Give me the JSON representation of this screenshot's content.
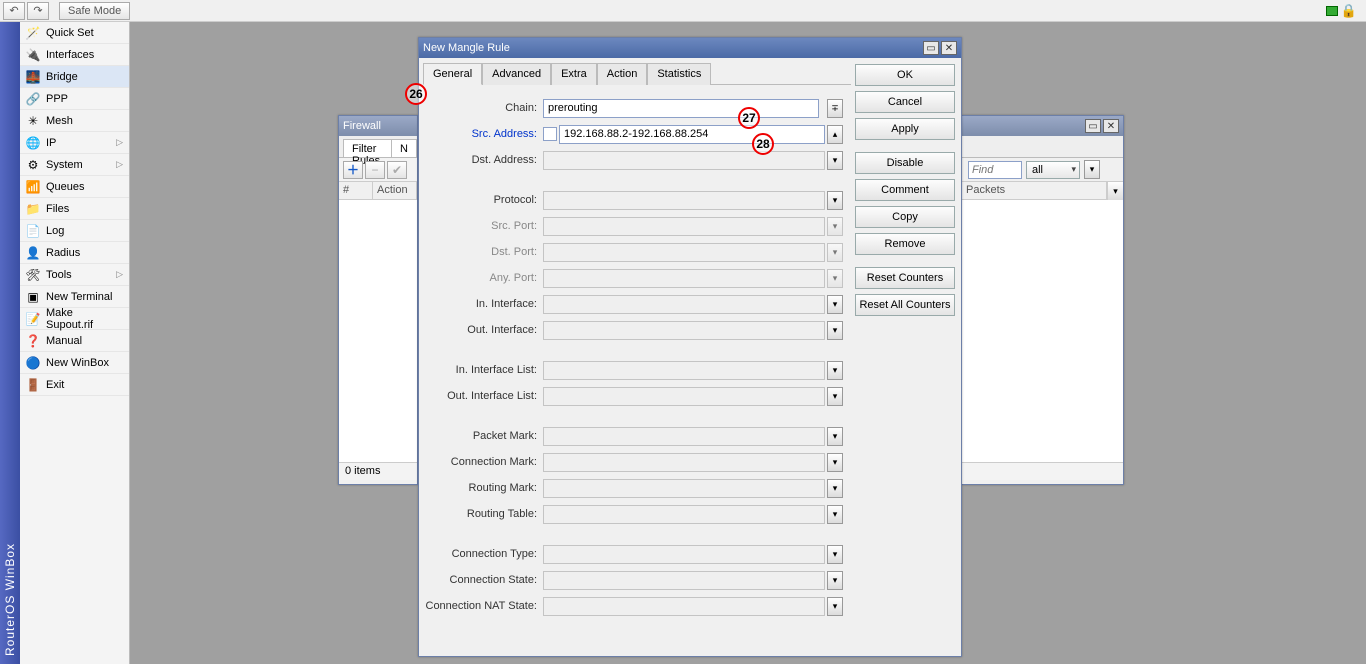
{
  "topbar": {
    "safe_mode": "Safe Mode"
  },
  "branding": "RouterOS WinBox",
  "sidebar": {
    "items": [
      {
        "label": "Quick Set",
        "icon": "🪄"
      },
      {
        "label": "Interfaces",
        "icon": "🔌"
      },
      {
        "label": "Bridge",
        "icon": "🌉",
        "active": true
      },
      {
        "label": "PPP",
        "icon": "🔗"
      },
      {
        "label": "Mesh",
        "icon": "✳"
      },
      {
        "label": "IP",
        "icon": "🌐",
        "expand": true
      },
      {
        "label": "System",
        "icon": "⚙",
        "expand": true
      },
      {
        "label": "Queues",
        "icon": "📶"
      },
      {
        "label": "Files",
        "icon": "📁"
      },
      {
        "label": "Log",
        "icon": "📄"
      },
      {
        "label": "Radius",
        "icon": "👤"
      },
      {
        "label": "Tools",
        "icon": "🛠",
        "expand": true
      },
      {
        "label": "New Terminal",
        "icon": "▣"
      },
      {
        "label": "Make Supout.rif",
        "icon": "📝"
      },
      {
        "label": "Manual",
        "icon": "❓"
      },
      {
        "label": "New WinBox",
        "icon": "🔵"
      },
      {
        "label": "Exit",
        "icon": "🚪"
      }
    ]
  },
  "firewall": {
    "title": "Firewall",
    "tabs": [
      "Filter Rules",
      "N"
    ],
    "cols": {
      "c1": "#",
      "c2": "Action"
    },
    "status": "0 items",
    "find_placeholder": "Find",
    "all": "all",
    "right_col": "Packets"
  },
  "dialog": {
    "title": "New Mangle Rule",
    "tabs": [
      "General",
      "Advanced",
      "Extra",
      "Action",
      "Statistics"
    ],
    "active_tab": 0,
    "labels": {
      "chain": "Chain:",
      "src": "Src. Address:",
      "dst": "Dst. Address:",
      "proto": "Protocol:",
      "srcport": "Src. Port:",
      "dstport": "Dst. Port:",
      "anyport": "Any. Port:",
      "inif": "In. Interface:",
      "outif": "Out. Interface:",
      "inifl": "In. Interface List:",
      "outifl": "Out. Interface List:",
      "pmark": "Packet Mark:",
      "cmark": "Connection Mark:",
      "rmark": "Routing Mark:",
      "rtable": "Routing Table:",
      "ctype": "Connection Type:",
      "cstate": "Connection State:",
      "cnat": "Connection NAT State:"
    },
    "values": {
      "chain": "prerouting",
      "src": "192.168.88.2-192.168.88.254"
    },
    "buttons": [
      "OK",
      "Cancel",
      "Apply",
      "Disable",
      "Comment",
      "Copy",
      "Remove",
      "Reset Counters",
      "Reset All Counters"
    ]
  },
  "callouts": {
    "a": "26",
    "b": "27",
    "c": "28"
  }
}
